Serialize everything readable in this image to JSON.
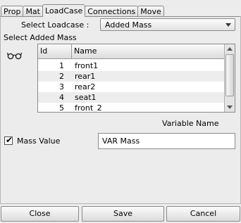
{
  "tabs": [
    {
      "label": "Prop"
    },
    {
      "label": "Mat"
    },
    {
      "label": "LoadCase",
      "active": true
    },
    {
      "label": "Connections"
    },
    {
      "label": "Move"
    }
  ],
  "loadcase": {
    "select_label": "Select Loadcase :",
    "selected_value": "Added Mass"
  },
  "added_mass": {
    "section_label": "Select Added Mass",
    "icon": "glasses-icon",
    "columns": {
      "id": "Id",
      "name": "Name"
    },
    "rows": [
      {
        "id": "1",
        "name": "front1"
      },
      {
        "id": "2",
        "name": "rear1"
      },
      {
        "id": "3",
        "name": "rear2"
      },
      {
        "id": "4",
        "name": "seat1"
      },
      {
        "id": "5",
        "name": "front_2"
      }
    ]
  },
  "variable": {
    "header": "Variable Name",
    "checkbox_label": "Mass Value",
    "checked": true,
    "value": "VAR Mass"
  },
  "buttons": {
    "close": "Close",
    "save": "Save",
    "cancel": "Cancel"
  }
}
